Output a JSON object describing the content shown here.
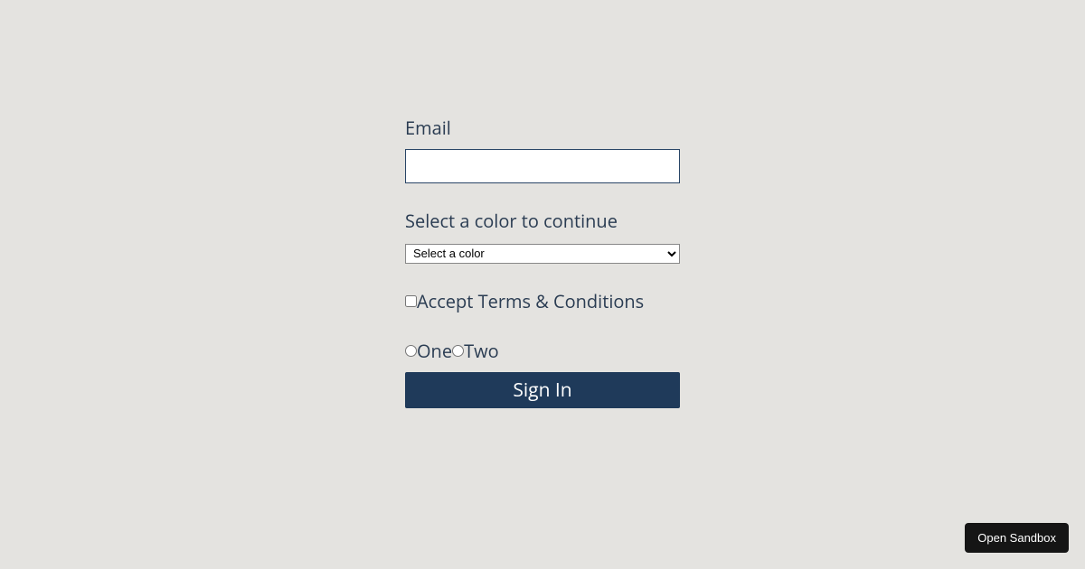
{
  "form": {
    "email": {
      "label": "Email",
      "value": ""
    },
    "color": {
      "label": "Select a color to continue",
      "selected": "Select a color"
    },
    "terms": {
      "label": "Accept Terms & Conditions",
      "checked": false
    },
    "radios": {
      "options": [
        "One",
        "Two"
      ]
    },
    "submit": {
      "label": "Sign In"
    }
  },
  "sandbox": {
    "label": "Open Sandbox"
  }
}
